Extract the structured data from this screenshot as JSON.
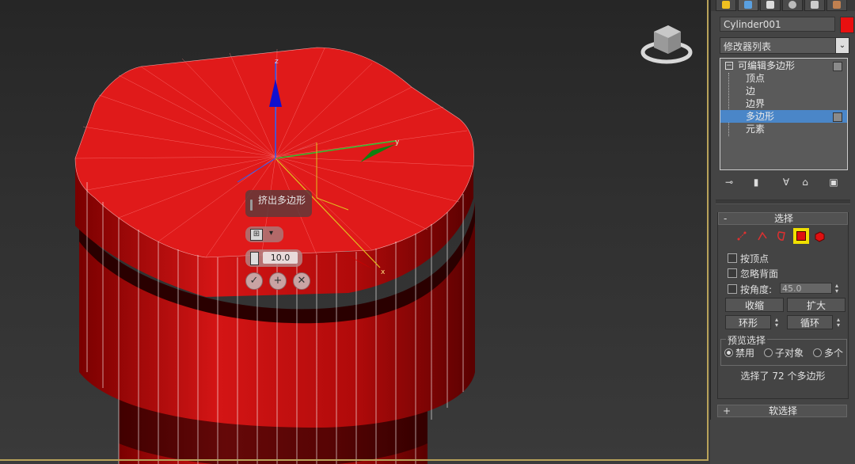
{
  "viewport": {
    "caddy": {
      "title": "挤出多边形",
      "type_icon": "group-icon",
      "height_value": "10.0",
      "ok_icon": "checkmark-icon",
      "apply_icon": "plus-icon",
      "cancel_icon": "close-icon"
    },
    "gizmo": {
      "z_label": "z",
      "y_label": "y",
      "x_label": "x"
    }
  },
  "command_panel": {
    "tabs": [
      "create-icon",
      "modify-icon",
      "hierarchy-icon",
      "motion-icon",
      "display-icon",
      "utilities-icon"
    ],
    "object_name": "Cylinder001",
    "object_color": "#e81010",
    "modifier_list": "修改器列表",
    "stack": {
      "root": "可编辑多边形",
      "items": [
        "顶点",
        "边",
        "边界",
        "多边形",
        "元素"
      ],
      "selected": "多边形"
    },
    "stack_tools": [
      "pin-stack-icon",
      "show-end-result-icon",
      "make-unique-icon",
      "remove-modifier-icon",
      "configure-modifier-sets-icon"
    ]
  },
  "selection_rollout": {
    "toggle": "-",
    "title": "选择",
    "subobject_icons": [
      "vertex-icon",
      "edge-icon",
      "border-icon",
      "polygon-icon",
      "element-icon"
    ],
    "active_subobject": "polygon-icon",
    "by_vertex": "按顶点",
    "ignore_backfacing": "忽略背面",
    "by_angle": "按角度:",
    "angle_value": "45.0",
    "shrink": "收缩",
    "grow": "扩大",
    "ring": "环形",
    "loop": "循环",
    "preview_title": "预览选择",
    "preview_options": [
      "禁用",
      "子对象",
      "多个"
    ],
    "preview_selected": "禁用",
    "status": "选择了 72 个多边形"
  },
  "soft_selection_rollout": {
    "toggle": "+",
    "title": "软选择"
  }
}
